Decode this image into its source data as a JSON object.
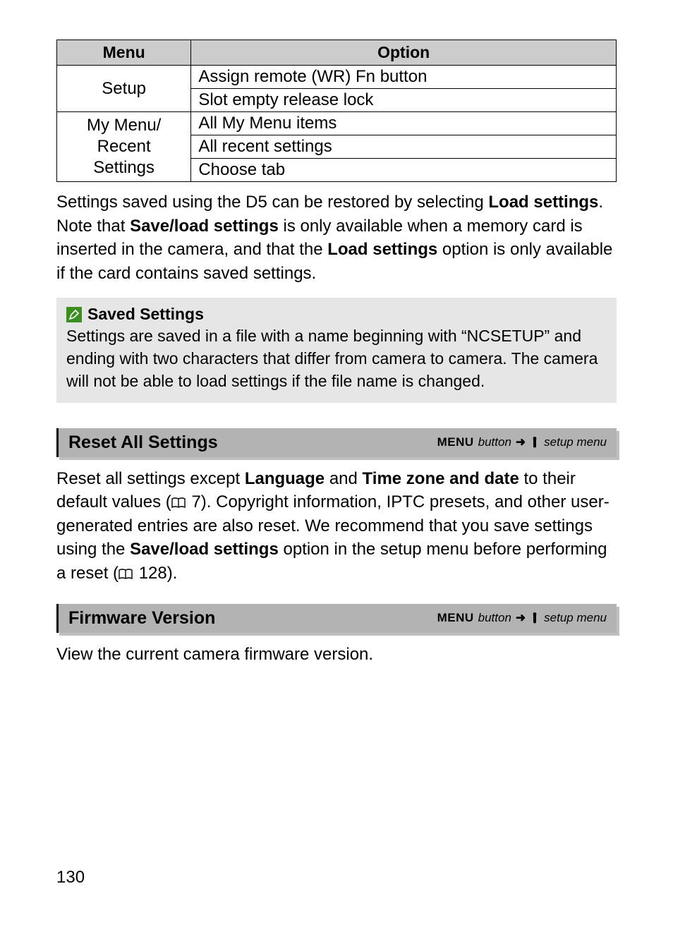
{
  "table": {
    "headers": {
      "menu": "Menu",
      "option": "Option"
    },
    "rows": [
      {
        "menu": "Setup",
        "options": [
          "Assign remote (WR) Fn button",
          "Slot empty release lock"
        ]
      },
      {
        "menu": "My Menu/\nRecent Settings",
        "options": [
          "All My Menu items",
          "All recent settings",
          "Choose tab"
        ]
      }
    ]
  },
  "para1": {
    "t1": "Settings saved using the D5 can be restored by selecting ",
    "b1": "Load settings",
    "t2": ".  Note that ",
    "b2": "Save/load settings",
    "t3": " is only available when a memory card is inserted in the camera, and that the ",
    "b3": "Load settings",
    "t4": " option is only available if the card contains saved settings."
  },
  "note": {
    "title": "Saved Settings",
    "body": "Settings are saved in a file with a name beginning with “NCSETUP” and ending with two characters that differ from camera to camera.  The camera will not be able to load settings if the file name is changed."
  },
  "section1": {
    "title": "Reset All Settings",
    "path": {
      "menu": "MENU",
      "button": "button",
      "setup": "setup menu"
    }
  },
  "para2": {
    "t1": "Reset all settings except ",
    "b1": "Language",
    "t2": " and ",
    "b2": "Time zone and date",
    "t3": " to their default values (",
    "p1": "7",
    "t4": ").  Copyright information, IPTC presets, and other user-generated entries are also reset.  We recommend that you save settings using the ",
    "b3": "Save/load settings",
    "t5": " option in the setup menu before performing a reset (",
    "p2": "128",
    "t6": ")."
  },
  "section2": {
    "title": "Firmware Version",
    "path": {
      "menu": "MENU",
      "button": "button",
      "setup": "setup menu"
    }
  },
  "para3": "View the current camera firmware version.",
  "page": "130"
}
